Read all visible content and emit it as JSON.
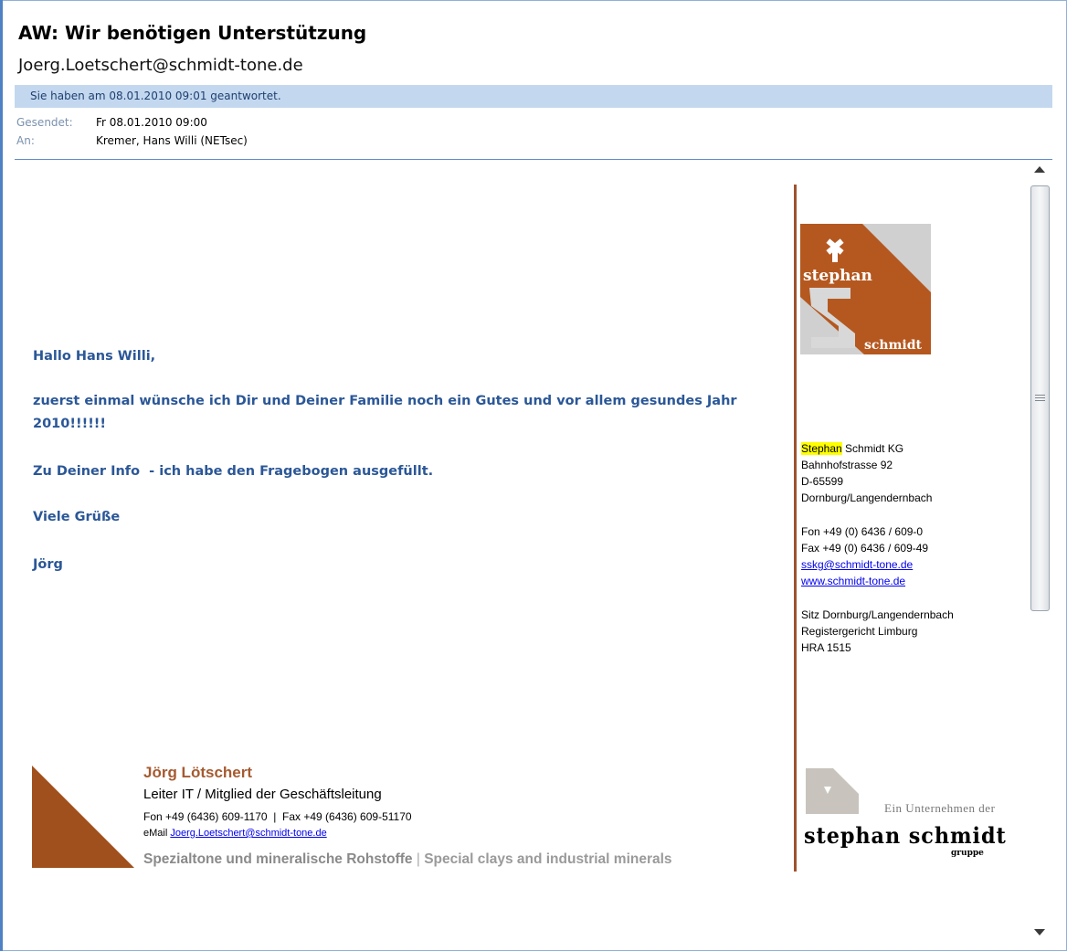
{
  "header": {
    "subject": "AW: Wir benötigen Unterstützung",
    "from": "Joerg.Loetschert@schmidt-tone.de",
    "info_bar": "Sie haben am 08.01.2010 09:01 geantwortet.",
    "sent_label": "Gesendet:",
    "sent_value": "Fr 08.01.2010 09:00",
    "to_label": "An:",
    "to_value": "Kremer, Hans Willi (NETsec)"
  },
  "body": {
    "greeting": "Hallo Hans Willi,",
    "para1_line1": "zuerst einmal wünsche ich Dir und Deiner Familie noch ein Gutes und vor allem gesundes Jahr",
    "para1_line2": "2010!!!!!!",
    "para2": "Zu Deiner Info  - ich habe den Fragebogen ausgefüllt.",
    "closing": "Viele Grüße",
    "name": "Jörg"
  },
  "right_column": {
    "logo_text_top": "stephan",
    "logo_text_bottom": "schmidt",
    "company_highlight": "Stephan",
    "company_rest": " Schmidt KG",
    "street": "Bahnhofstrasse 92",
    "zip": "D-65599",
    "city": "Dornburg/Langendernbach",
    "fon": "Fon +49 (0) 6436 / 609-0",
    "fax": "Fax +49 (0) 6436 / 609-49",
    "email": "sskg@schmidt-tone.de",
    "web": "www.schmidt-tone.de",
    "seat": "Sitz Dornburg/Langendernbach",
    "register": "Registergericht Limburg",
    "hra": "HRA 1515",
    "group_tagline": "Ein Unternehmen der",
    "group_name": "stephan schmidt",
    "group_sub": "gruppe"
  },
  "signature": {
    "name": "Jörg Lötschert",
    "role": "Leiter IT / Mitglied der Geschäftsleitung",
    "fon_fax": "Fon +49 (6436) 609-1170  |  Fax +49 (6436) 609-51170",
    "email_label": "eMail ",
    "email": "Joerg.Loetschert@schmidt-tone.de",
    "tagline_de": "Spezialtone und mineralische Rohstoffe",
    "tagline_sep": " | ",
    "tagline_en": "Special clays and industrial minerals"
  },
  "colors": {
    "brand_brown": "#b5581f",
    "link": "#0000ee",
    "body_text": "#2b5797",
    "info_bar": "#c3d8ef"
  }
}
